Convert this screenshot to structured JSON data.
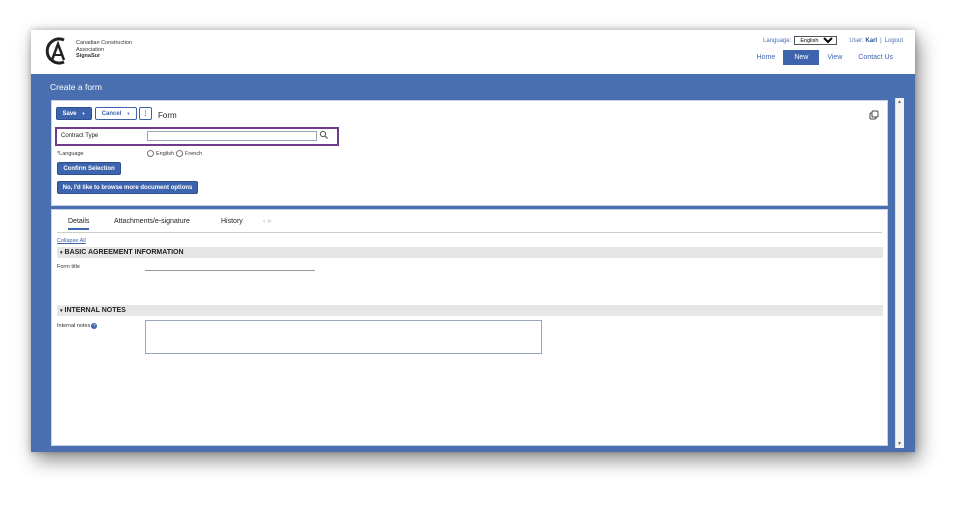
{
  "org": {
    "line1": "Canadian Construction",
    "line2": "Association",
    "line3": "SignaSur"
  },
  "header": {
    "language_label": "Language:",
    "language_value": "English",
    "user_label": "User:",
    "user_name": "Karl",
    "separator": "|",
    "logout": "Logout"
  },
  "nav": {
    "items": [
      {
        "label": "Home",
        "active": false
      },
      {
        "label": "New",
        "active": true
      },
      {
        "label": "View",
        "active": false
      },
      {
        "label": "Contact Us",
        "active": false
      }
    ]
  },
  "page": {
    "title": "Create a form"
  },
  "toolbar": {
    "save_label": "Save",
    "cancel_label": "Cancel",
    "more_label": "⋮",
    "form_label": "Form"
  },
  "contract": {
    "label": "Contract Type",
    "value": ""
  },
  "language_field": {
    "label": "*Language",
    "option_english": "English",
    "option_french": "French"
  },
  "buttons": {
    "confirm": "Confirm Selection",
    "browse": "No, I'd like to browse more document options"
  },
  "tabs": {
    "details": "Details",
    "attachments": "Attachments/e-signature",
    "history": "History",
    "arrows": "‹ »"
  },
  "details": {
    "collapse_all": "Collapse All",
    "section_basic": "BASIC AGREEMENT INFORMATION",
    "form_title_label": "Form title",
    "section_notes": "INTERNAL NOTES",
    "internal_notes_label": "Internal notes"
  },
  "colors": {
    "brand_blue": "#4a6fb0",
    "button_blue": "#3d64ad",
    "highlight_purple": "#6e3b8e"
  }
}
